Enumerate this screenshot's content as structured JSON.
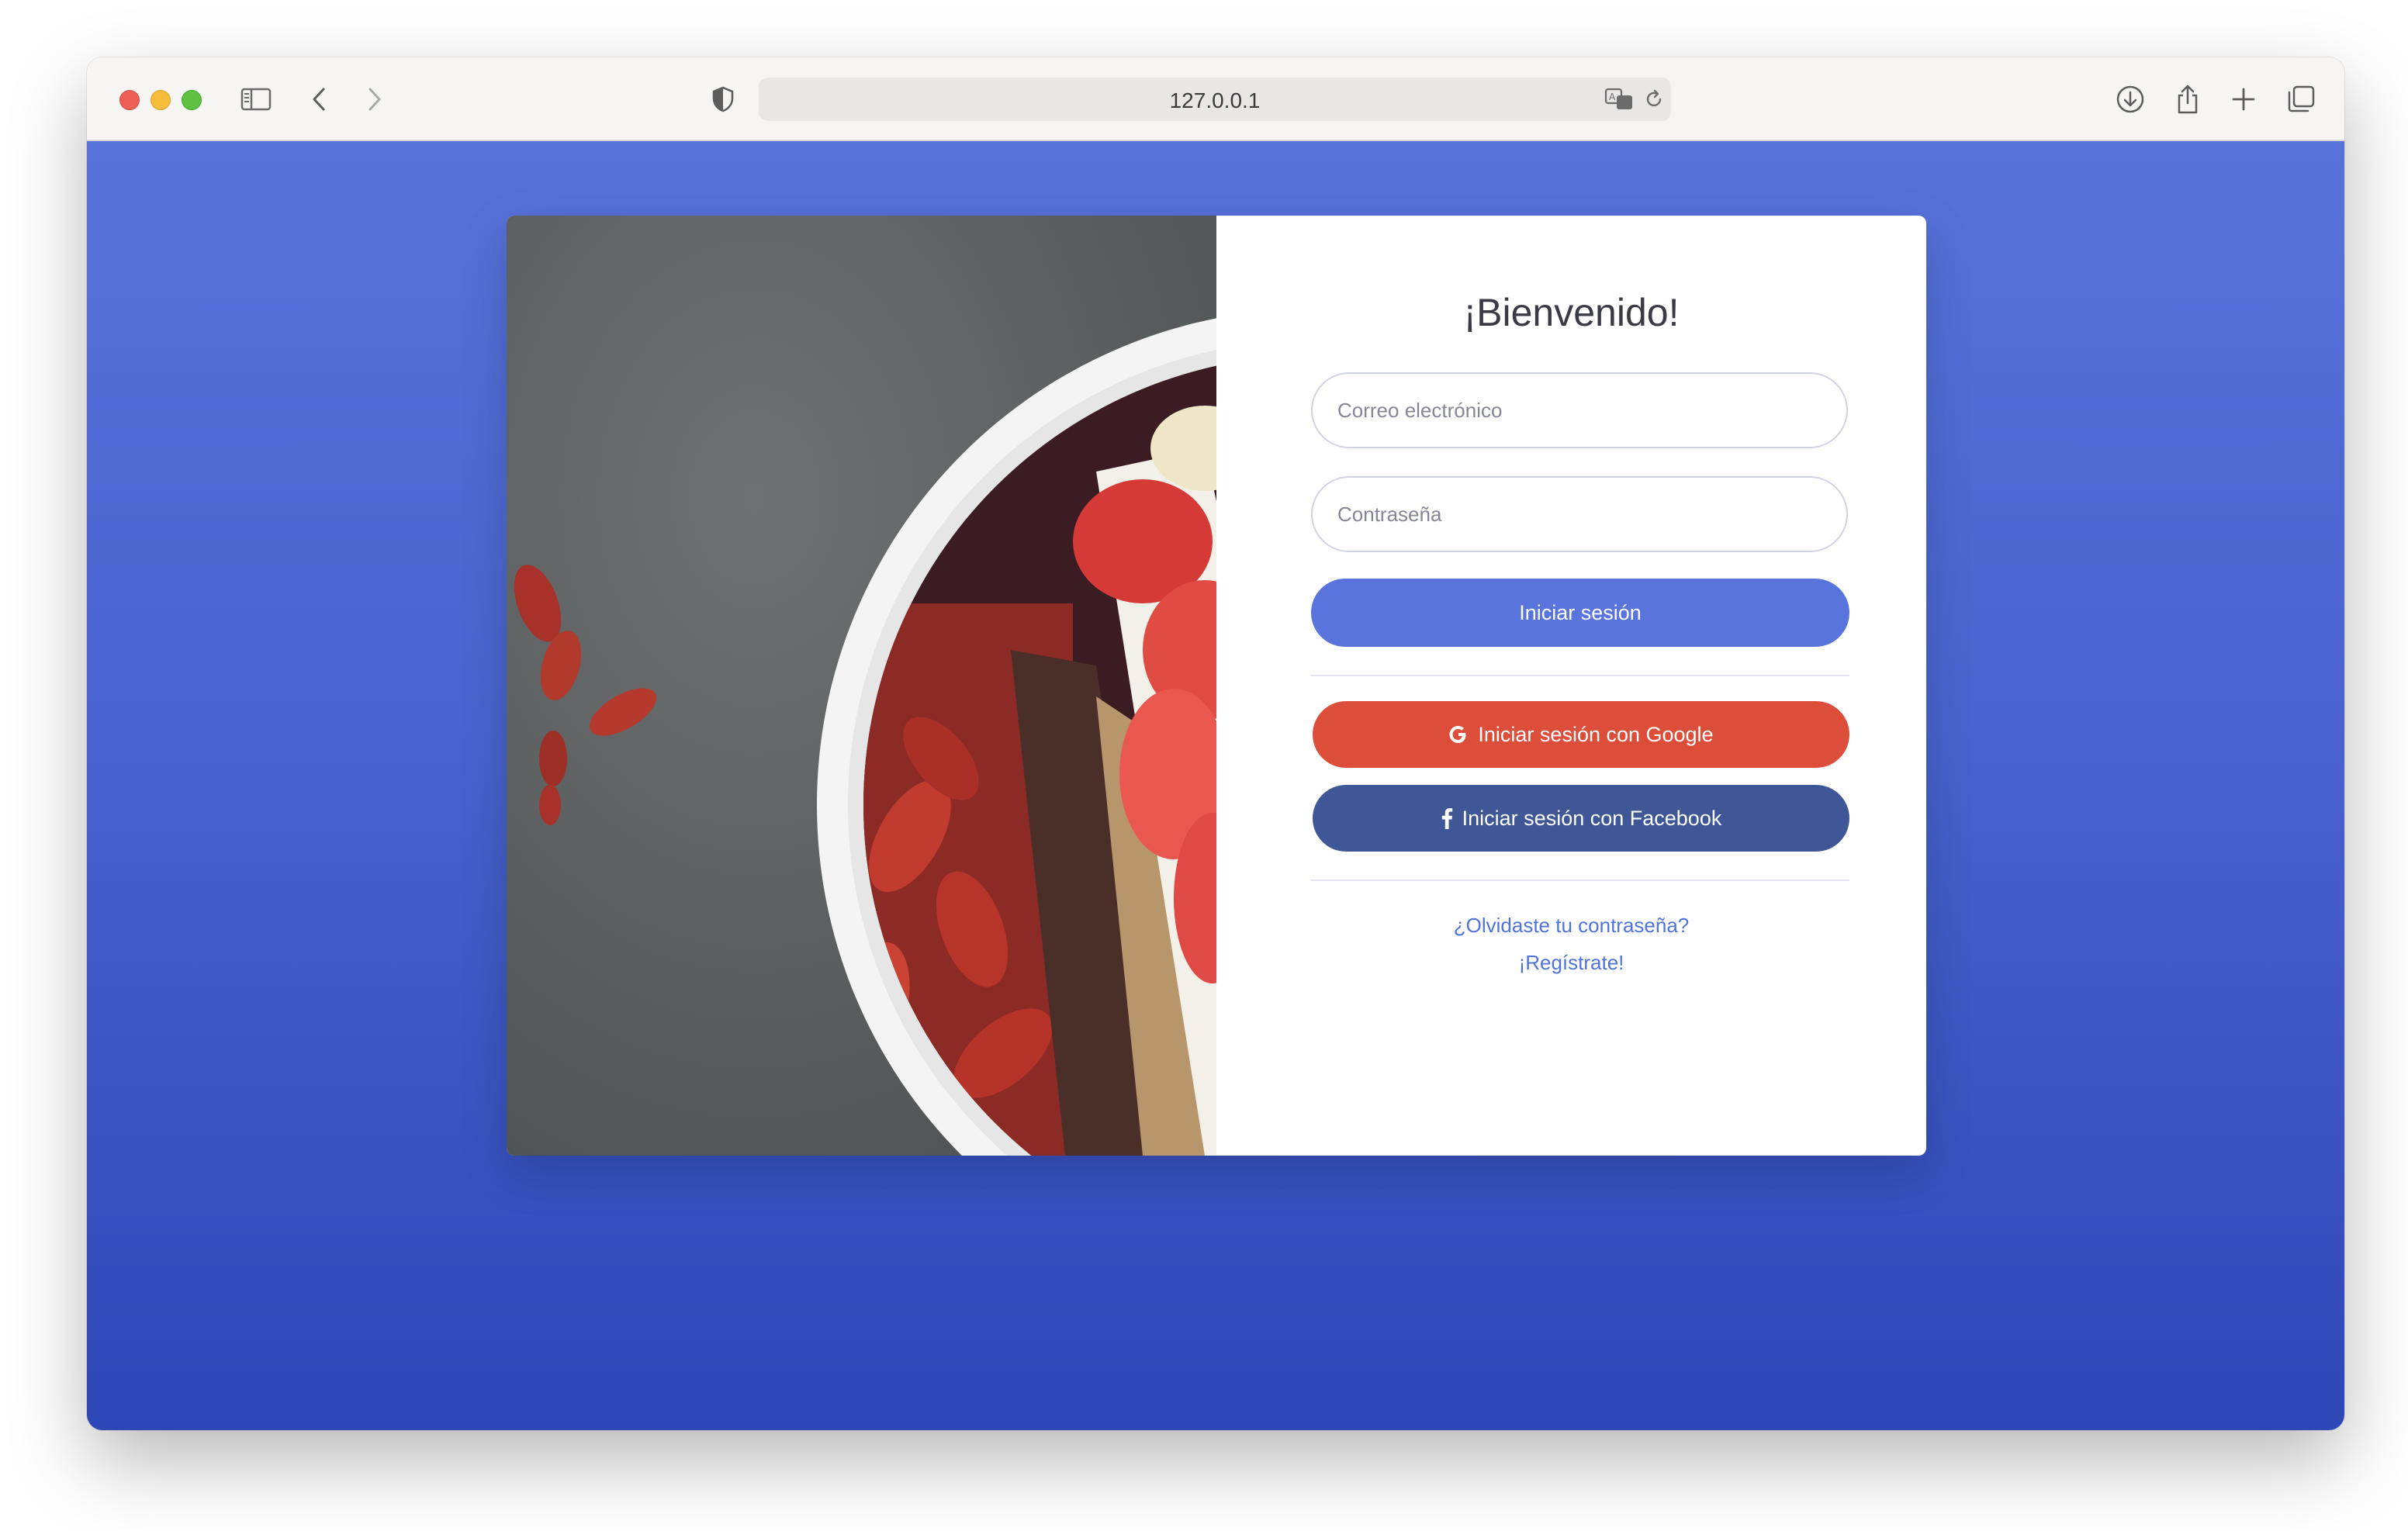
{
  "browser": {
    "address": "127.0.0.1",
    "icons": [
      "sidebar-icon",
      "back-icon",
      "forward-icon",
      "shield-icon",
      "translate-icon",
      "reload-icon",
      "download-icon",
      "share-icon",
      "new-tab-icon",
      "tabs-overview-icon"
    ]
  },
  "colors": {
    "background_top": "#5773db",
    "background_bottom": "#2e47b6",
    "primary": "#5a74dd",
    "google": "#dd4e3a",
    "facebook": "#3f5797",
    "link": "#4e73df"
  },
  "login": {
    "title": "¡Bienvenido!",
    "email_placeholder": "Correo electrónico",
    "password_placeholder": "Contraseña",
    "submit_label": "Iniciar sesión",
    "google_label": "Iniciar sesión con Google",
    "facebook_label": "Iniciar sesión con Facebook",
    "forgot_label": "¿Olvidaste tu contraseña?",
    "register_label": "¡Regístrate!"
  }
}
